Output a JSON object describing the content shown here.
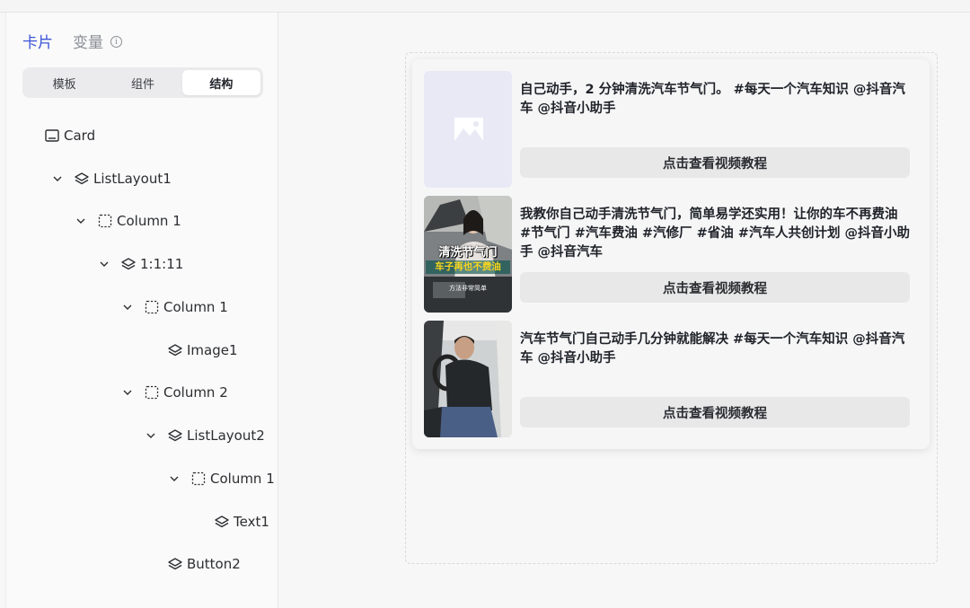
{
  "panel": {
    "tabs": [
      "卡片",
      "变量"
    ],
    "info_icon": "info-circle-icon",
    "segments": [
      "模板",
      "组件",
      "结构"
    ],
    "active_segment": "结构"
  },
  "tree": [
    {
      "label": "Card",
      "icon": "card-icon",
      "expanded": null
    },
    {
      "label": "ListLayout1",
      "icon": "layers-icon",
      "expanded": true
    },
    {
      "label": "Column 1",
      "icon": "dashed-box-icon",
      "expanded": true
    },
    {
      "label": "1:1:11",
      "icon": "layers-icon",
      "expanded": true
    },
    {
      "label": "Column 1",
      "icon": "dashed-box-icon",
      "expanded": true
    },
    {
      "label": "Image1",
      "icon": "layers-icon",
      "expanded": null
    },
    {
      "label": "Column 2",
      "icon": "dashed-box-icon",
      "expanded": true
    },
    {
      "label": "ListLayout2",
      "icon": "layers-icon",
      "expanded": true
    },
    {
      "label": "Column 1",
      "icon": "dashed-box-icon",
      "expanded": true
    },
    {
      "label": "Text1",
      "icon": "layers-icon",
      "expanded": null
    },
    {
      "label": "Button2",
      "icon": "layers-icon",
      "expanded": null
    }
  ],
  "card": {
    "rows": [
      {
        "title": "自己动手，2 分钟清洗汽车节气门。 #每天一个汽车知识 @抖音汽车 @抖音小助手",
        "button": "点击查看视频教程",
        "thumb": "placeholder"
      },
      {
        "title": "我教你自己动手清洗节气门，简单易学还实用！让你的车不再费油 #节气门 #汽车费油 #汽修厂 #省油 #汽车人共创计划 @抖音小助手 @抖音汽车",
        "button": "点击查看视频教程",
        "thumb": "photo-woman",
        "overlay": [
          "清洗节气门",
          "车子再也不费油",
          "方法非常简单"
        ]
      },
      {
        "title": "汽车节气门自己动手几分钟就能解决 #每天一个汽车知识 @抖音汽车 @抖音小助手",
        "button": "点击查看视频教程",
        "thumb": "photo-man"
      }
    ]
  },
  "colors": {
    "accent": "#3b54d8",
    "button_bg": "#e8e8e9",
    "placeholder_bg": "#e9e9f6"
  }
}
